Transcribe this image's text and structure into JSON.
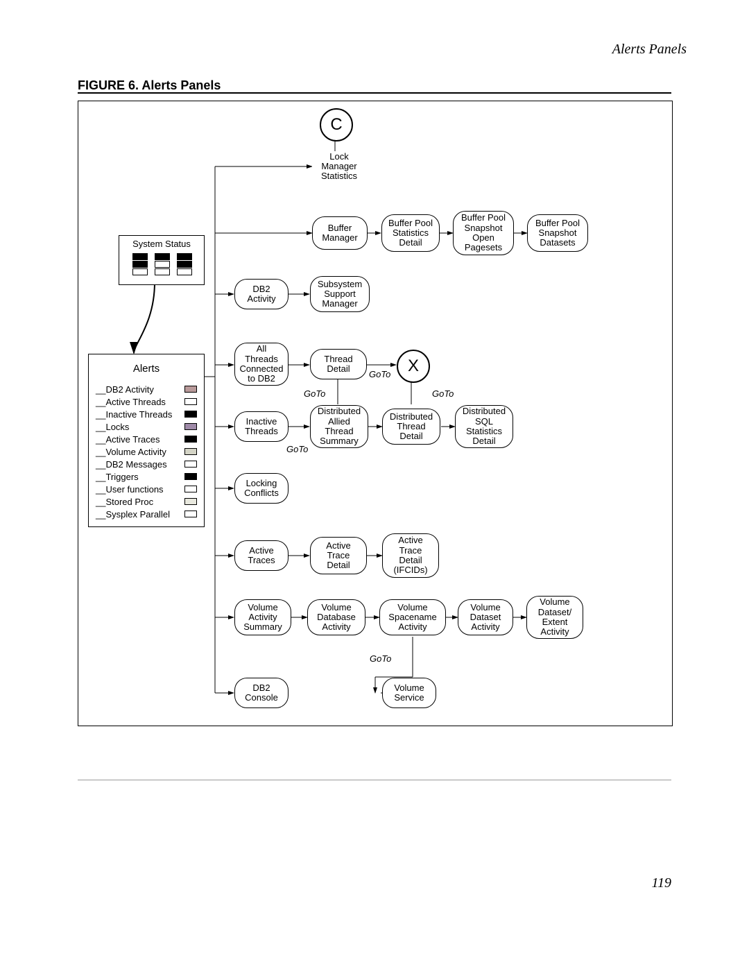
{
  "header": {
    "running_head": "Alerts Panels"
  },
  "figure": {
    "label": "FIGURE 6.  Alerts Panels"
  },
  "page_number": "119",
  "connector_c": "C",
  "connector_x": "X",
  "system_status": {
    "title": "System Status"
  },
  "alerts": {
    "title": "Alerts",
    "items": [
      {
        "label": "DB2 Activity",
        "sw": "#B99A9A"
      },
      {
        "label": "Active Threads",
        "sw": ""
      },
      {
        "label": "Inactive Threads",
        "sw": "#000"
      },
      {
        "label": "Locks",
        "sw": "#9F8AA8"
      },
      {
        "label": "Active Traces",
        "sw": "#000"
      },
      {
        "label": "Volume Activity",
        "sw": "#D4D4C6"
      },
      {
        "label": "DB2 Messages",
        "sw": ""
      },
      {
        "label": "Triggers",
        "sw": "#000"
      },
      {
        "label": "User functions",
        "sw": ""
      },
      {
        "label": "Stored Proc",
        "sw": "#E8E8DE"
      },
      {
        "label": "Sysplex Parallel",
        "sw": ""
      }
    ]
  },
  "nodes": {
    "lock_mgr": "Lock\nManager\nStatistics",
    "buf_mgr": "Buffer\nManager",
    "bp_stat_det": "Buffer Pool\nStatistics\nDetail",
    "bp_snap_open": "Buffer Pool\nSnapshot\nOpen\nPagesets",
    "bp_snap_ds": "Buffer Pool\nSnapshot\nDatasets",
    "db2_activity": "DB2\nActivity",
    "sub_sup_mgr": "Subsystem\nSupport\nManager",
    "all_threads": "All\nThreads\nConnected\nto DB2",
    "thread_det": "Thread\nDetail",
    "inactive_thr": "Inactive\nThreads",
    "dist_allied": "Distributed\nAllied\nThread\nSummary",
    "dist_thr_det": "Distributed\nThread\nDetail",
    "dist_sql_det": "Distributed\nSQL\nStatistics\nDetail",
    "lock_conf": "Locking\nConflicts",
    "act_traces": "Active\nTraces",
    "act_trace_det": "Active\nTrace\nDetail",
    "act_trace_ifc": "Active\nTrace\nDetail\n(IFCIDs)",
    "vol_act_sum": "Volume\nActivity\nSummary",
    "vol_db_act": "Volume\nDatabase\nActivity",
    "vol_space_act": "Volume\nSpacename\nActivity",
    "vol_ds_act": "Volume\nDataset\nActivity",
    "vol_ds_ext": "Volume\nDataset/\nExtent\nActivity",
    "db2_console": "DB2\nConsole",
    "vol_service": "Volume\nService"
  },
  "labels": {
    "goto": "GoTo"
  }
}
